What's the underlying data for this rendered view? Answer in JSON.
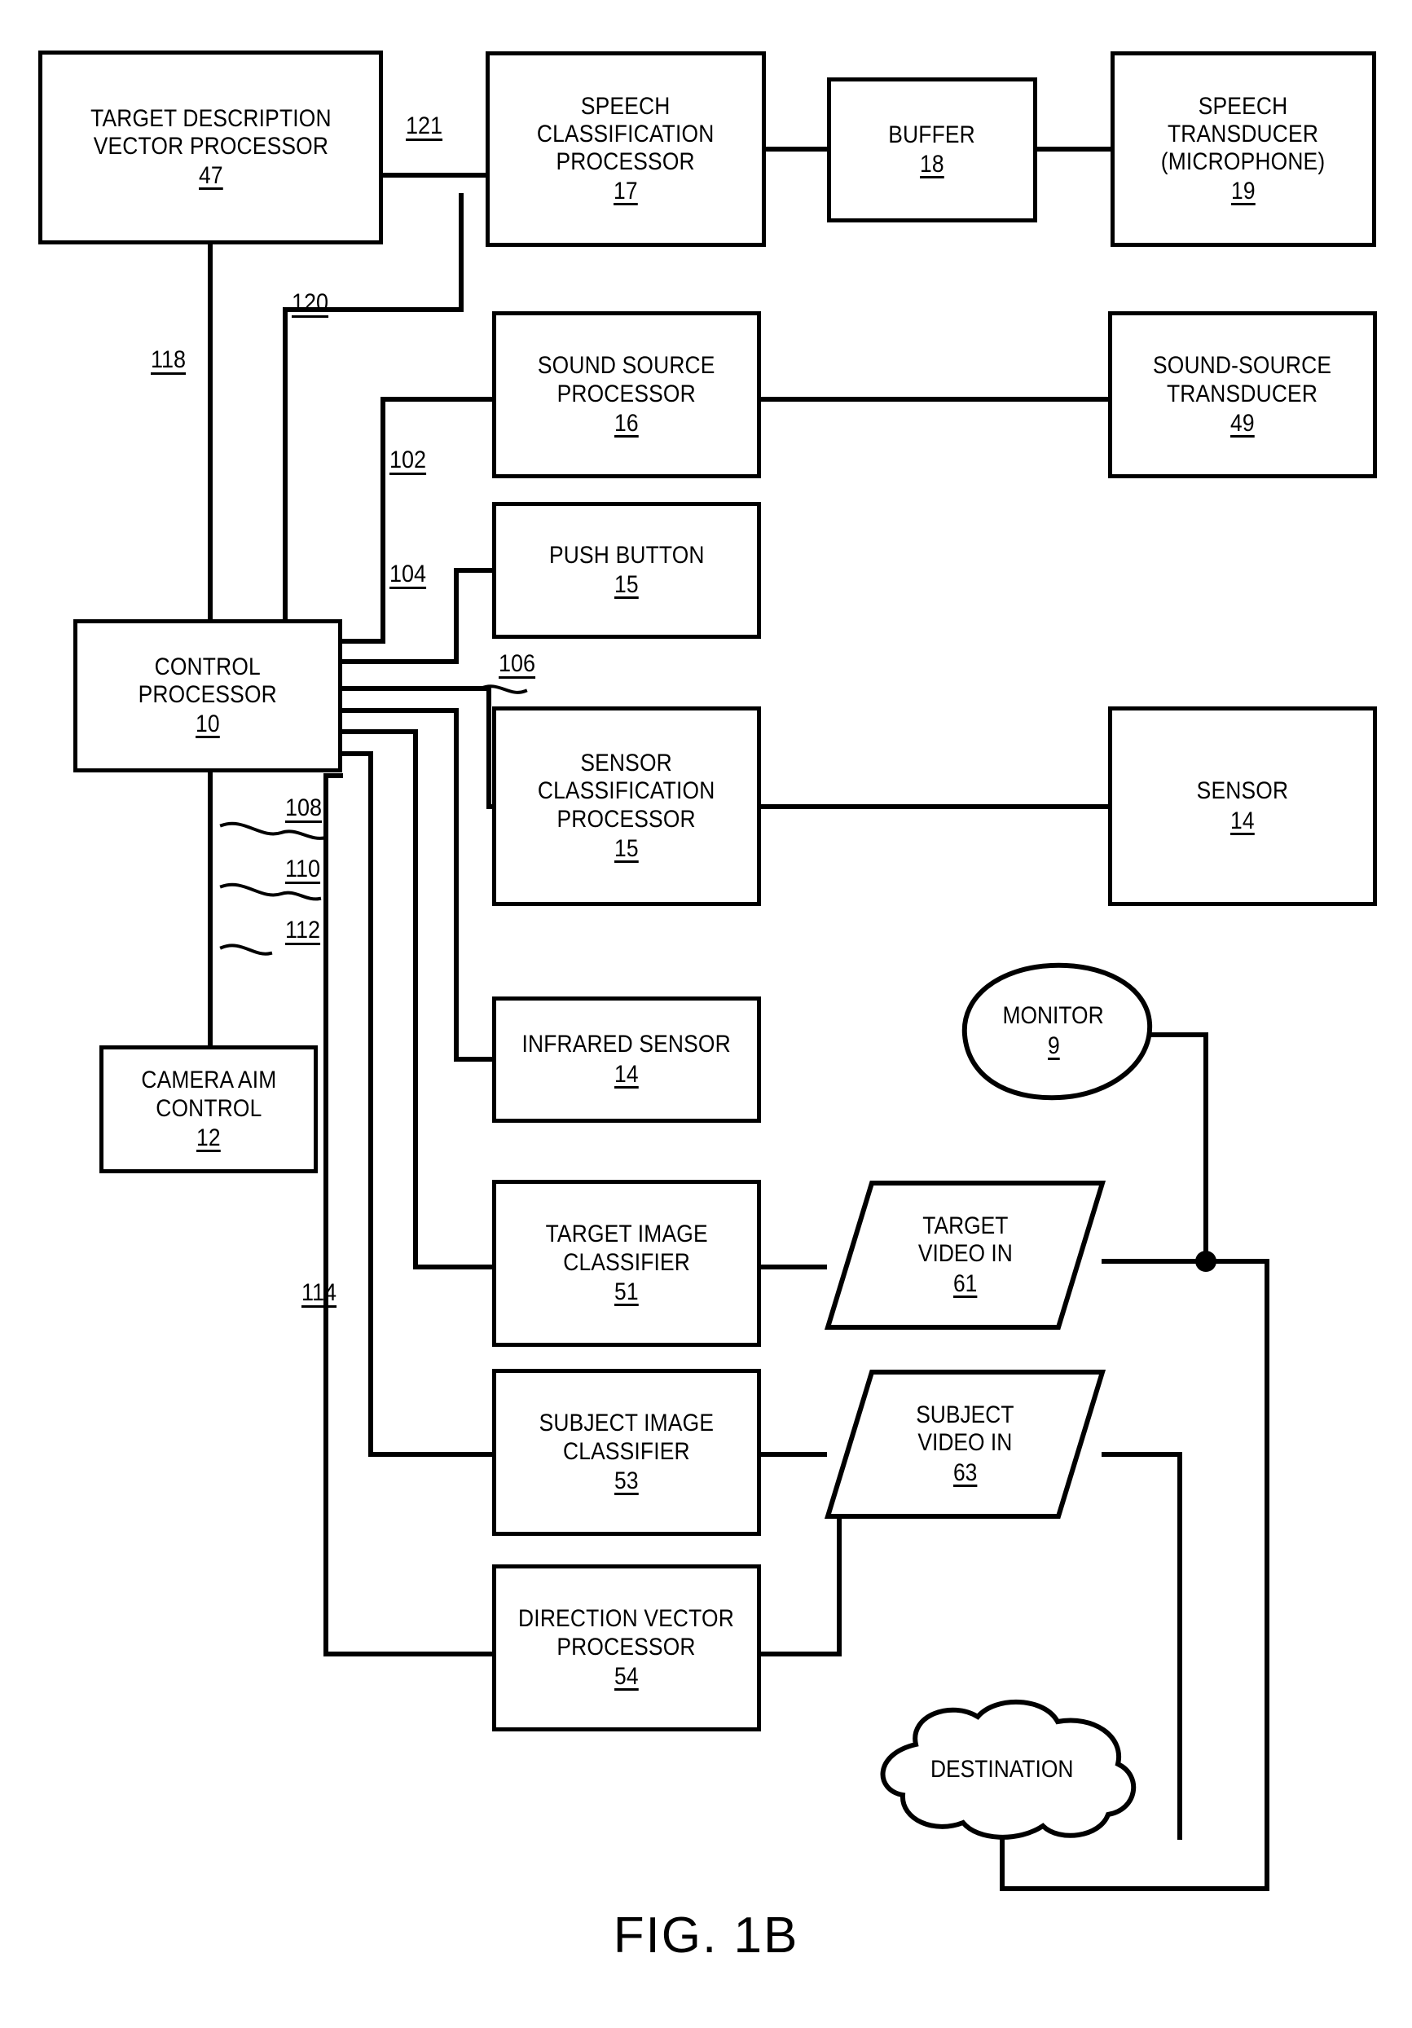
{
  "figure": {
    "caption": "FIG. 1B"
  },
  "nodes": [
    {
      "id": "target_description_vector_processor",
      "label": "TARGET DESCRIPTION\nVECTOR PROCESSOR",
      "ref": "47",
      "shape": "rect"
    },
    {
      "id": "speech_classification_processor",
      "label": "SPEECH\nCLASSIFICATION\nPROCESSOR",
      "ref": "17",
      "shape": "rect"
    },
    {
      "id": "buffer",
      "label": "BUFFER",
      "ref": "18",
      "shape": "rect"
    },
    {
      "id": "speech_transducer",
      "label": "SPEECH\nTRANSDUCER\n(MICROPHONE)",
      "ref": "19",
      "shape": "rect"
    },
    {
      "id": "sound_source_processor",
      "label": "SOUND SOURCE\nPROCESSOR",
      "ref": "16",
      "shape": "rect"
    },
    {
      "id": "sound_source_transducer",
      "label": "SOUND-SOURCE\nTRANSDUCER",
      "ref": "49",
      "shape": "rect"
    },
    {
      "id": "push_button",
      "label": "PUSH BUTTON",
      "ref": "15",
      "shape": "rect"
    },
    {
      "id": "control_processor",
      "label": "CONTROL\nPROCESSOR",
      "ref": "10",
      "shape": "rect"
    },
    {
      "id": "sensor_classification_processor",
      "label": "SENSOR\nCLASSIFICATION\nPROCESSOR",
      "ref": "15",
      "shape": "rect"
    },
    {
      "id": "sensor",
      "label": "SENSOR",
      "ref": "14",
      "shape": "rect"
    },
    {
      "id": "infrared_sensor",
      "label": "INFRARED SENSOR",
      "ref": "14",
      "shape": "rect"
    },
    {
      "id": "camera_aim_control",
      "label": "CAMERA AIM\nCONTROL",
      "ref": "12",
      "shape": "rect"
    },
    {
      "id": "monitor",
      "label": "MONITOR",
      "ref": "9",
      "shape": "blob"
    },
    {
      "id": "target_image_classifier",
      "label": "TARGET IMAGE\nCLASSIFIER",
      "ref": "51",
      "shape": "rect"
    },
    {
      "id": "target_video_in",
      "label": "TARGET\nVIDEO IN",
      "ref": "61",
      "shape": "parallelogram"
    },
    {
      "id": "subject_image_classifier",
      "label": "SUBJECT IMAGE\nCLASSIFIER",
      "ref": "53",
      "shape": "rect"
    },
    {
      "id": "subject_video_in",
      "label": "SUBJECT\nVIDEO IN",
      "ref": "63",
      "shape": "parallelogram"
    },
    {
      "id": "direction_vector_processor",
      "label": "DIRECTION VECTOR\nPROCESSOR",
      "ref": "54",
      "shape": "rect"
    },
    {
      "id": "destination",
      "label": "DESTINATION",
      "ref": "",
      "shape": "cloud"
    }
  ],
  "wire_labels": [
    {
      "id": "wire_121",
      "text": "121"
    },
    {
      "id": "wire_120",
      "text": "120"
    },
    {
      "id": "wire_118",
      "text": "118"
    },
    {
      "id": "wire_102",
      "text": "102"
    },
    {
      "id": "wire_104",
      "text": "104"
    },
    {
      "id": "wire_106",
      "text": "106"
    },
    {
      "id": "wire_108",
      "text": "108"
    },
    {
      "id": "wire_110",
      "text": "110"
    },
    {
      "id": "wire_112",
      "text": "112"
    },
    {
      "id": "wire_114",
      "text": "114"
    }
  ]
}
